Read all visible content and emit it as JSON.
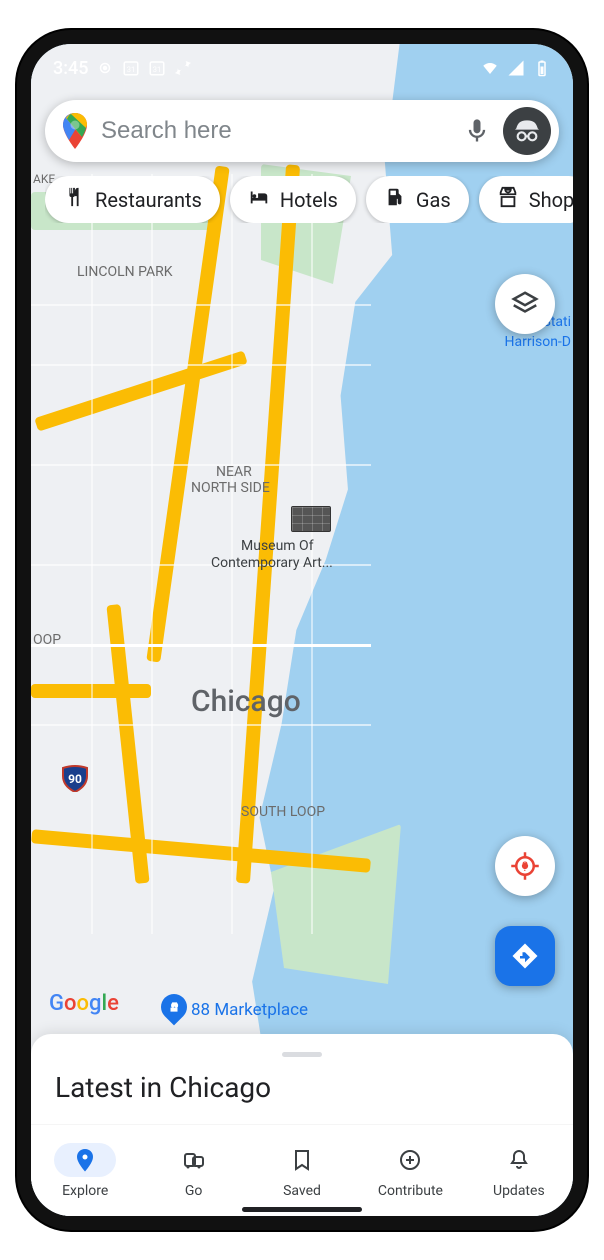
{
  "status": {
    "time": "3:45"
  },
  "search": {
    "placeholder": "Search here"
  },
  "chips": [
    {
      "label": "Restaurants",
      "icon": "restaurant-icon"
    },
    {
      "label": "Hotels",
      "icon": "hotel-icon"
    },
    {
      "label": "Gas",
      "icon": "gas-icon"
    },
    {
      "label": "Shop",
      "icon": "shop-icon"
    }
  ],
  "map": {
    "city_label": "Chicago",
    "neighborhoods": {
      "lincoln_park": "LINCOLN PARK",
      "near_north_side_1": "NEAR",
      "near_north_side_2": "NORTH SIDE",
      "south_loop": "SOUTH LOOP",
      "loop_partial": "OOP",
      "ake_partial": "AKE"
    },
    "poi": {
      "museum_line1": "Museum Of",
      "museum_line2": "Contemporary Art...",
      "marketplace": "88 Marketplace"
    },
    "water_labels": {
      "line1": "Stati",
      "line2": "Harrison-D"
    },
    "shields": {
      "interstate": "90"
    }
  },
  "sheet": {
    "title": "Latest in Chicago"
  },
  "nav": {
    "items": [
      {
        "key": "explore",
        "label": "Explore",
        "active": true
      },
      {
        "key": "go",
        "label": "Go",
        "active": false
      },
      {
        "key": "saved",
        "label": "Saved",
        "active": false
      },
      {
        "key": "contribute",
        "label": "Contribute",
        "active": false
      },
      {
        "key": "updates",
        "label": "Updates",
        "active": false
      }
    ]
  },
  "attribution": "Google"
}
